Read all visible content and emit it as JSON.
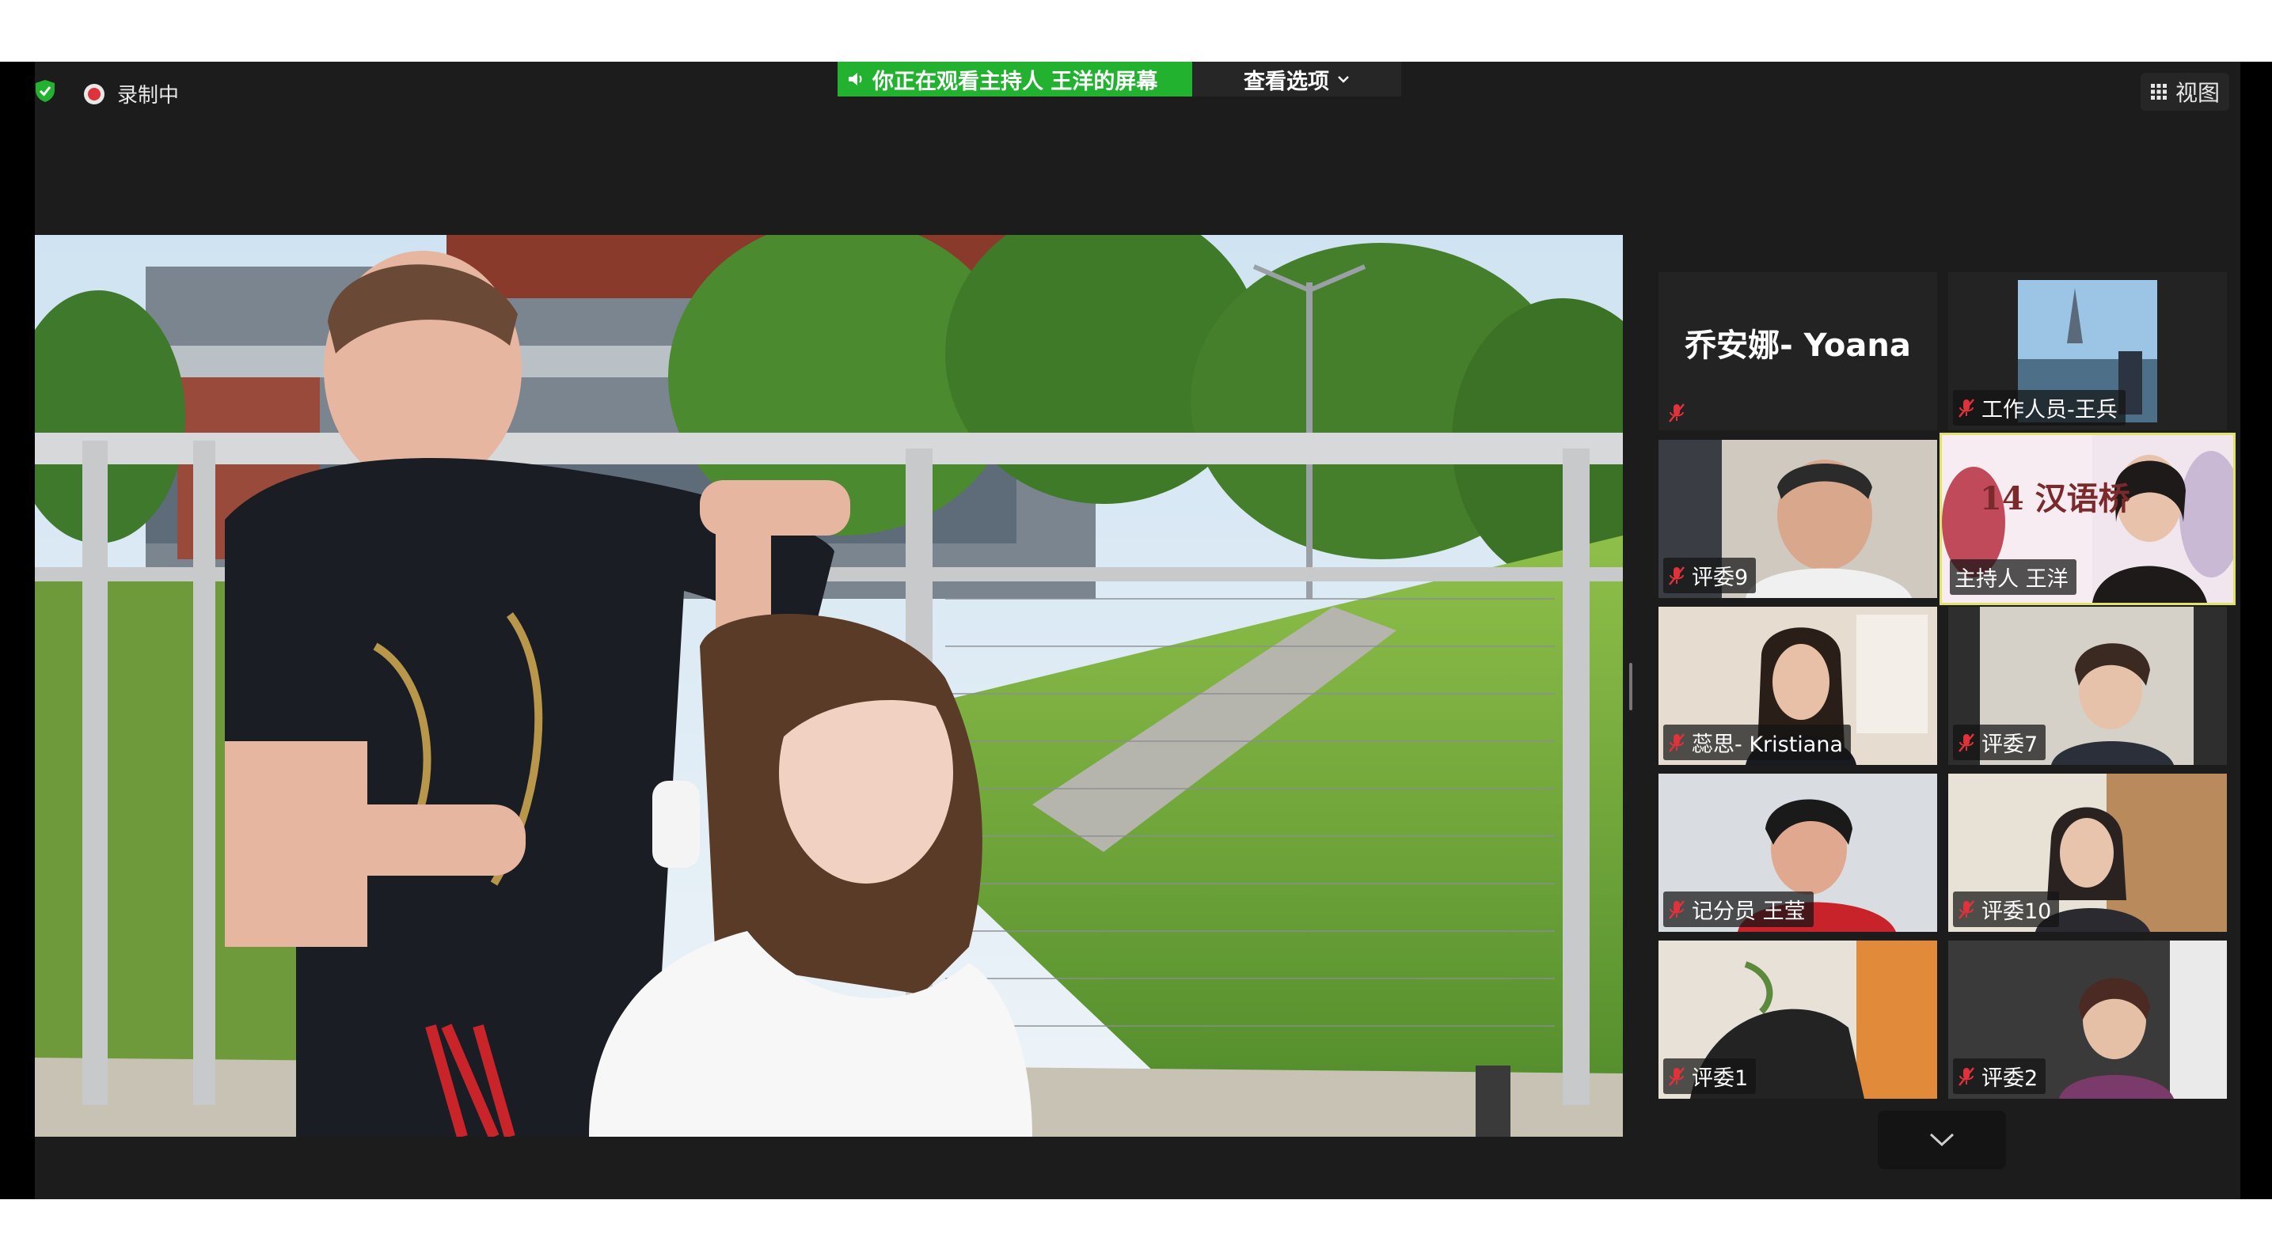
{
  "topbar": {
    "recording_label": "录制中",
    "share_notice": "你正在观看主持人   王洋的屏幕",
    "view_options_label": "查看选项",
    "view_button_label": "视图"
  },
  "participants": [
    {
      "name": "乔安娜- Yoana",
      "display": "乔安娜- Yoana",
      "video": false
    },
    {
      "name": "工作人员-王兵",
      "video": true
    },
    {
      "name": "评委9",
      "video": true
    },
    {
      "name": "主持人   王洋",
      "video": true,
      "active_speaker": true,
      "banner_text": "14 汉语桥"
    },
    {
      "name": "蕊思- Kristiana",
      "video": true
    },
    {
      "name": "评委7",
      "video": true
    },
    {
      "name": "记分员 王莹",
      "video": true
    },
    {
      "name": "评委10",
      "video": true
    },
    {
      "name": "评委1",
      "video": true
    },
    {
      "name": "评委2",
      "video": true
    }
  ],
  "colors": {
    "share_green": "#23b130",
    "active_outline": "#e0e26a",
    "mic_muted_red": "#e0323a",
    "window_bg": "#1c1c1c"
  },
  "icons": [
    "shield-icon",
    "record-icon",
    "speaker-icon",
    "chevron-down-icon",
    "grid-icon",
    "mic-muted-icon",
    "chevron-down-icon"
  ]
}
